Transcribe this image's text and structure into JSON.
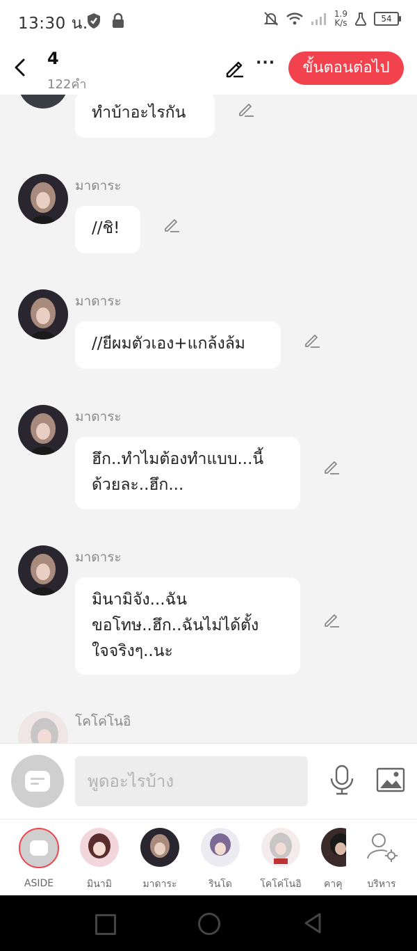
{
  "status_bar": {
    "time": "13:30 น.",
    "net_speed_value": "1.9",
    "net_speed_unit": "K/s",
    "battery": "54"
  },
  "header": {
    "title": "4",
    "word_count": "122คำ",
    "next_button": "ขั้นตอนต่อไป",
    "more_label": "···"
  },
  "messages": [
    {
      "speaker": "",
      "lines": [
        "ทำบ้าอะไรกัน"
      ]
    },
    {
      "speaker": "มาดาระ",
      "lines": [
        "//ชิ!"
      ]
    },
    {
      "speaker": "มาดาระ",
      "lines": [
        "//ยีผมตัวเอง+แกล้งล้ม"
      ]
    },
    {
      "speaker": "มาดาระ",
      "lines": [
        "ฮึก..ทำไมต้องทำแบบ...นี้",
        "ด้วยละ..ฮึก..."
      ]
    },
    {
      "speaker": "มาดาระ",
      "lines": [
        "มินามิจัง...ฉัน",
        "ขอโทษ..ฮึก..ฉันไม่ได้ตั้ง",
        "ใจจริงๆ..นะ"
      ]
    },
    {
      "speaker": "โคโค่โนอิ",
      "lines": []
    }
  ],
  "composer": {
    "placeholder": "พูดอะไรบ้าง"
  },
  "characters": [
    {
      "name": "ASIDE"
    },
    {
      "name": "มินามิ"
    },
    {
      "name": "มาดาระ"
    },
    {
      "name": "รินโด"
    },
    {
      "name": "โคโค่โนอิ"
    },
    {
      "name": "คาคุ"
    },
    {
      "name": "บริหาร"
    }
  ],
  "colors": {
    "accent": "#f2424d",
    "background": "#f3f3f3",
    "bubble": "#ffffff"
  }
}
